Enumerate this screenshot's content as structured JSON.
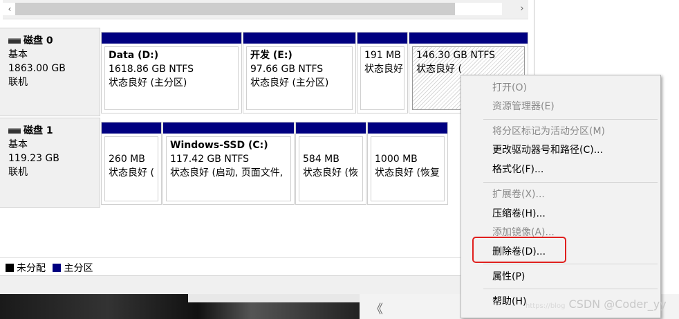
{
  "scrollbar": {
    "left_arrow": "‹",
    "right_arrow": "›"
  },
  "disks": [
    {
      "title": "磁盘 0",
      "type": "基本",
      "size": "1863.00 GB",
      "status": "联机",
      "partitions": [
        {
          "name": "Data  (D:)",
          "size": "1618.86 GB NTFS",
          "status": "状态良好 (主分区)",
          "selected": false
        },
        {
          "name": "开发  (E:)",
          "size": "97.66 GB NTFS",
          "status": "状态良好 (主分区)",
          "selected": false
        },
        {
          "name": "",
          "size": "191 MB",
          "status": "状态良好",
          "selected": false
        },
        {
          "name": "",
          "size": "146.30 GB NTFS",
          "status": "状态良好 (",
          "selected": true
        }
      ]
    },
    {
      "title": "磁盘 1",
      "type": "基本",
      "size": "119.23 GB",
      "status": "联机",
      "partitions": [
        {
          "name": "",
          "size": "260 MB",
          "status": "状态良好 (",
          "selected": false
        },
        {
          "name": "Windows-SSD  (C:)",
          "size": "117.42 GB NTFS",
          "status": "状态良好 (启动, 页面文件,",
          "selected": false
        },
        {
          "name": "",
          "size": "584 MB",
          "status": "状态良好 (恢",
          "selected": false
        },
        {
          "name": "",
          "size": "1000 MB",
          "status": "状态良好 (恢复",
          "selected": false
        }
      ]
    }
  ],
  "legend": {
    "unallocated": "未分配",
    "primary": "主分区",
    "unallocated_color": "#000000",
    "primary_color": "#000080"
  },
  "context_menu": {
    "items": [
      {
        "label": "打开(O)",
        "enabled": false
      },
      {
        "label": "资源管理器(E)",
        "enabled": false
      },
      {
        "label": "将分区标记为活动分区(M)",
        "enabled": false
      },
      {
        "label": "更改驱动器号和路径(C)...",
        "enabled": true
      },
      {
        "label": "格式化(F)...",
        "enabled": true
      },
      {
        "label": "扩展卷(X)...",
        "enabled": false
      },
      {
        "label": "压缩卷(H)...",
        "enabled": true
      },
      {
        "label": "添加镜像(A)...",
        "enabled": false
      },
      {
        "label": "删除卷(D)...",
        "enabled": true
      },
      {
        "label": "属性(P)",
        "enabled": true
      },
      {
        "label": "帮助(H)",
        "enabled": true
      }
    ],
    "highlight_color": "#e0201e"
  },
  "watermark": {
    "faint": "https://blog",
    "main": "CSDN @Coder_yy"
  },
  "taskbar": {
    "chevron": "《"
  }
}
